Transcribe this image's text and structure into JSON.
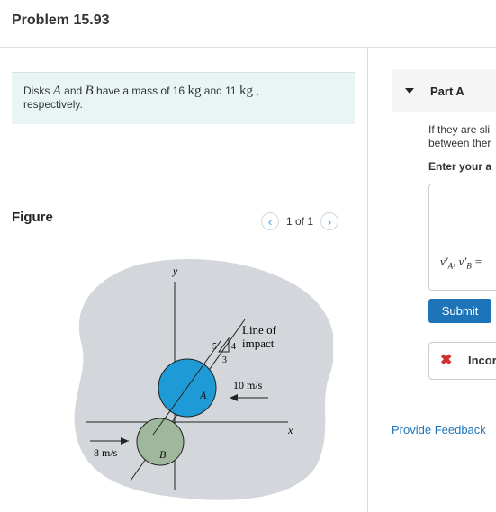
{
  "header": {
    "title": "Problem 15.93"
  },
  "problem": {
    "part1": "Disks ",
    "var_a": "A",
    "part2": " and ",
    "var_b": "B",
    "part3": " have a mass of 16 ",
    "unit1": "kg",
    "part4": " and 11 ",
    "unit2": "kg",
    "part5": " ,",
    "line2": "respectively."
  },
  "figure_panel": {
    "label": "Figure",
    "pagination": "1 of 1",
    "prev_icon": "chevron-left-icon",
    "next_icon": "chevron-right-icon"
  },
  "figure": {
    "axis_y": "y",
    "axis_x": "x",
    "disk_a": "A",
    "disk_b": "B",
    "line_of_impact_1": "Line of",
    "line_of_impact_2": "impact",
    "tri_5": "5",
    "tri_4": "4",
    "tri_3": "3",
    "speed_a": "10 m/s",
    "speed_b": "8 m/s",
    "colors": {
      "disk_a": "#1e9ad6",
      "disk_b": "#9fb79c",
      "backdrop": "#d3d6da"
    }
  },
  "part": {
    "label": "Part A",
    "question_line1": "If they are sli",
    "question_line2": "between ther",
    "enter_label": "Enter your a",
    "answer_var": "v′A, v′B =",
    "submit": "Submit",
    "feedback_text": "Incor",
    "provide_feedback": "Provide Feedback"
  }
}
